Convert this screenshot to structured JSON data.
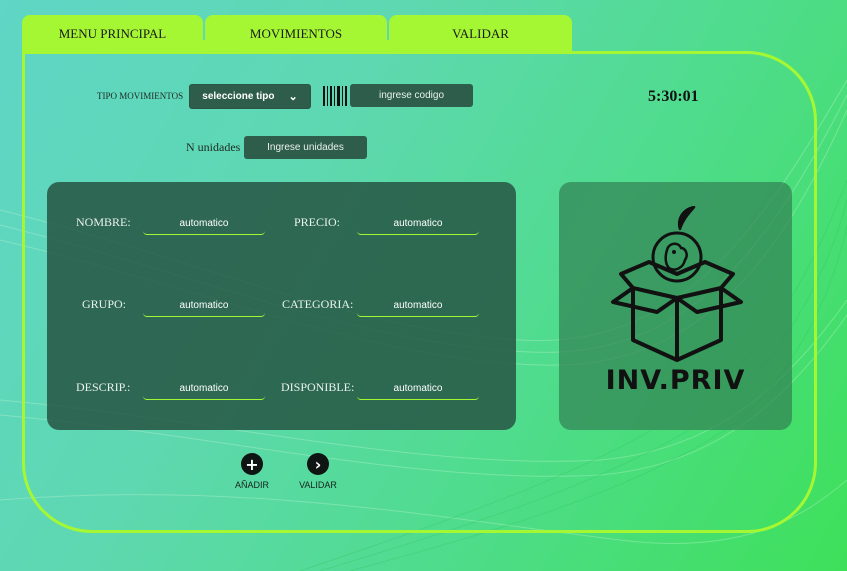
{
  "tabs": [
    {
      "label": "MENU PRINCIPAL"
    },
    {
      "label": "MOVIMIENTOS"
    },
    {
      "label": "VALIDAR"
    }
  ],
  "movement": {
    "type_label": "TIPO MOVIMIENTOS",
    "type_select_value": "seleccione tipo",
    "code_placeholder": "ingrese codigo",
    "units_label": "N unidades",
    "units_placeholder": "Ingrese unidades"
  },
  "clock": "5:30:01",
  "details": {
    "nombre_label": "NOMBRE:",
    "nombre_value": "automatico",
    "precio_label": "PRECIO:",
    "precio_value": "automatico",
    "grupo_label": "GRUPO:",
    "grupo_value": "automatico",
    "categoria_label": "CATEGORIA:",
    "categoria_value": "automatico",
    "descrip_label": "DESCRIP.:",
    "descrip_value": "automatico",
    "disponible_label": "DISPONIBLE:",
    "disponible_value": "automatico"
  },
  "logo": {
    "text": "INV.PRIV"
  },
  "actions": {
    "add_label": "AÑADIR",
    "validate_label": "VALIDAR"
  },
  "icons": {
    "add": "plus-circle-icon",
    "validate": "chevron-right-circle-icon",
    "barcode": "barcode-icon",
    "select": "chevron-down-icon"
  },
  "colors": {
    "accent": "#a6f733",
    "panel": "#2e5e4b"
  }
}
